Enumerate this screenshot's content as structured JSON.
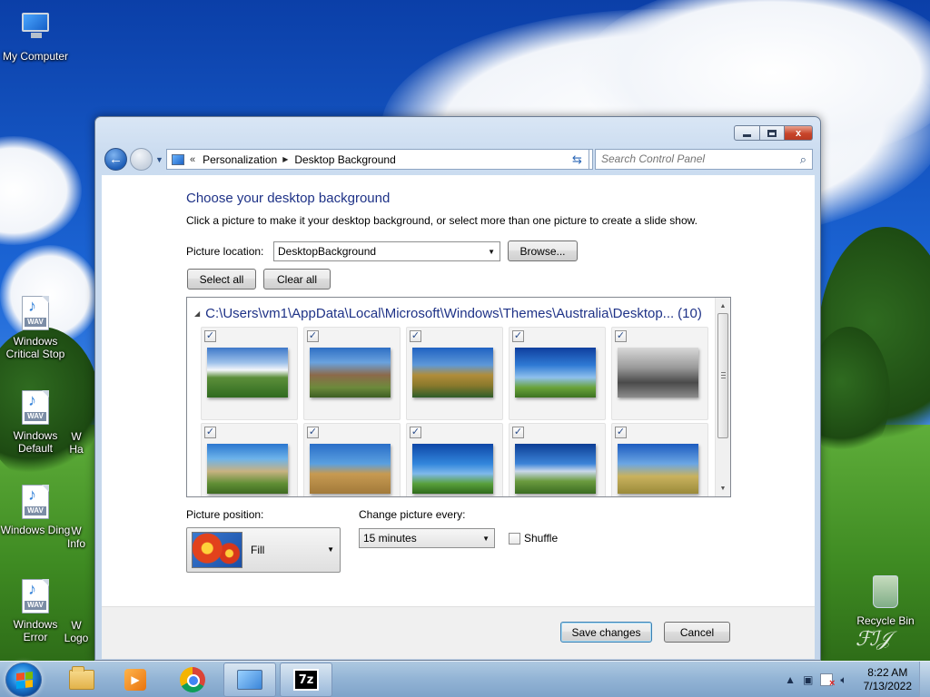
{
  "desktop": {
    "icons": [
      {
        "label": "My Computer",
        "icon": "computer-icon"
      },
      {
        "label": "Windows Critical Stop",
        "icon": "wav-file-icon"
      },
      {
        "label": "Windows Default",
        "icon": "wav-file-icon"
      },
      {
        "label": "Windows Ding",
        "icon": "wav-file-icon"
      },
      {
        "label": "Windows Error",
        "icon": "wav-file-icon"
      },
      {
        "label": "Recycle Bin",
        "icon": "recycle-bin-icon"
      }
    ],
    "partial_labels": [
      "W",
      "Ha",
      "W",
      "Info",
      "W",
      "Logo"
    ],
    "wav_tag": "WAV"
  },
  "window": {
    "caption_buttons": {
      "minimize": "minimize",
      "maximize": "maximize",
      "close": "x"
    },
    "nav": {
      "chevron": "«",
      "breadcrumbs": [
        "Personalization",
        "Desktop Background"
      ],
      "search_placeholder": "Search Control Panel"
    },
    "content": {
      "title": "Choose your desktop background",
      "subtitle": "Click a picture to make it your desktop background, or select more than one picture to create a slide show.",
      "picture_location_label": "Picture location:",
      "picture_location_value": "DesktopBackground",
      "browse_label": "Browse...",
      "select_all_label": "Select all",
      "clear_all_label": "Clear all",
      "group_path": "C:\\Users\\vm1\\AppData\\Local\\Microsoft\\Windows\\Themes\\Australia\\Desktop...",
      "group_count": "(10)",
      "pictures": [
        {
          "checked": true,
          "scene": "clouds-over-field"
        },
        {
          "checked": true,
          "scene": "ruined-stone-house"
        },
        {
          "checked": true,
          "scene": "river-gorge"
        },
        {
          "checked": true,
          "scene": "blue-sky-pasture"
        },
        {
          "checked": true,
          "scene": "black-white-tree"
        },
        {
          "checked": true,
          "scene": "coastal-hills"
        },
        {
          "checked": true,
          "scene": "hay-bale"
        },
        {
          "checked": true,
          "scene": "lone-tree"
        },
        {
          "checked": true,
          "scene": "rolling-farmland"
        },
        {
          "checked": true,
          "scene": "golden-hills"
        }
      ],
      "check_mark": "✓",
      "picture_position_label": "Picture position:",
      "picture_position_value": "Fill",
      "change_picture_label": "Change picture every:",
      "change_picture_value": "15 minutes",
      "shuffle_label": "Shuffle",
      "shuffle_checked": false
    },
    "footer": {
      "save_label": "Save changes",
      "cancel_label": "Cancel"
    }
  },
  "taskbar": {
    "pinned": [
      "explorer-icon",
      "media-player-icon",
      "chrome-icon",
      "control-panel-icon",
      "7zip-icon"
    ],
    "seven_zip_label": "7z",
    "clock_time": "8:22 AM",
    "clock_date": "7/13/2022"
  },
  "colors": {
    "title_blue": "#1e3287",
    "taskbar": "#96b6de"
  }
}
